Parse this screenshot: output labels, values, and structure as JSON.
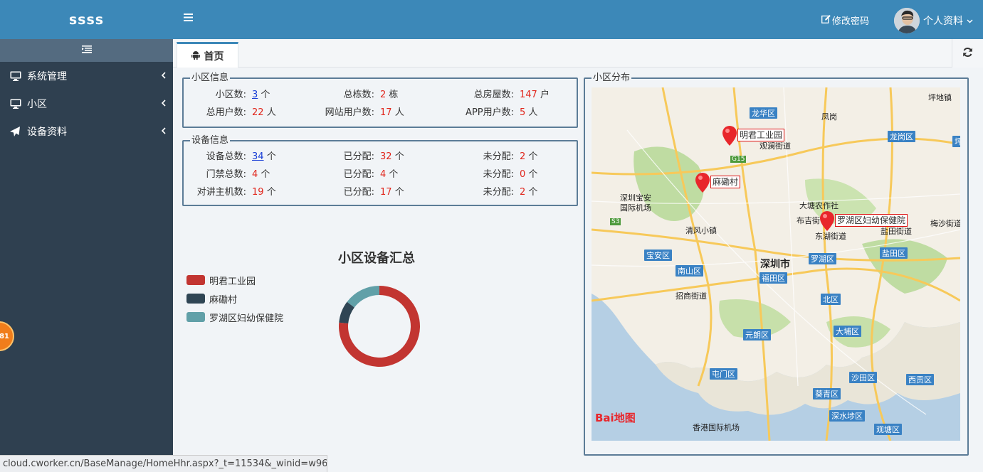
{
  "sidebar": {
    "brand": "ssss",
    "items": [
      {
        "label": "系统管理",
        "icon": "monitor-icon"
      },
      {
        "label": "小区",
        "icon": "monitor-icon"
      },
      {
        "label": "设备资料",
        "icon": "send-icon"
      }
    ],
    "floating_badge": "81"
  },
  "header": {
    "change_password": "修改密码",
    "user_menu": "个人资料"
  },
  "tabs": [
    {
      "label": "首页",
      "icon": "android-icon"
    }
  ],
  "community_info": {
    "legend": "小区信息",
    "rows": [
      [
        {
          "label": "小区数:",
          "value": "3",
          "unit": "个",
          "link": true
        },
        {
          "label": "总栋数:",
          "value": "2",
          "unit": "栋"
        },
        {
          "label": "总房屋数:",
          "value": "147",
          "unit": "户"
        }
      ],
      [
        {
          "label": "总用户数:",
          "value": "22",
          "unit": "人"
        },
        {
          "label": "网站用户数:",
          "value": "17",
          "unit": "人"
        },
        {
          "label": "APP用户数:",
          "value": "5",
          "unit": "人"
        }
      ]
    ]
  },
  "device_info": {
    "legend": "设备信息",
    "rows": [
      [
        {
          "label": "设备总数:",
          "value": "34",
          "unit": "个",
          "link": true
        },
        {
          "label": "已分配:",
          "value": "32",
          "unit": "个"
        },
        {
          "label": "未分配:",
          "value": "2",
          "unit": "个"
        }
      ],
      [
        {
          "label": "门禁总数:",
          "value": "4",
          "unit": "个"
        },
        {
          "label": "已分配:",
          "value": "4",
          "unit": "个"
        },
        {
          "label": "未分配:",
          "value": "0",
          "unit": "个"
        }
      ],
      [
        {
          "label": "对讲主机数:",
          "value": "19",
          "unit": "个"
        },
        {
          "label": "已分配:",
          "value": "17",
          "unit": "个"
        },
        {
          "label": "未分配:",
          "value": "2",
          "unit": "个"
        }
      ]
    ]
  },
  "chart_data": {
    "type": "pie",
    "title": "小区设备汇总",
    "legend_position": "left",
    "categories": [
      "明君工业园",
      "麻磡村",
      "罗湖区妇幼保健院"
    ],
    "values": [
      26,
      3,
      5
    ],
    "colors": [
      "#c23531",
      "#2f4554",
      "#61a0a8"
    ]
  },
  "map": {
    "legend": "小区分布",
    "markers": [
      {
        "label": "明君工业园"
      },
      {
        "label": "麻磡村"
      },
      {
        "label": "罗湖区妇幼保健院"
      }
    ],
    "area_tags": [
      "龙华区",
      "龙岗区",
      "宝安区",
      "南山区",
      "福田区",
      "罗湖区",
      "盐田区",
      "北区",
      "大埔区",
      "元朗区",
      "屯门区",
      "沙田区",
      "西贡区",
      "葵青区",
      "深水埗区",
      "观塘区",
      "坪"
    ],
    "places": [
      "坪地镇",
      "凤岗",
      "深圳宝安",
      "国际机场",
      "大塘农作社",
      "布吉街",
      "东湖街道",
      "梅沙街道",
      "盐田街道",
      "清风小镇",
      "深圳市",
      "招商街道",
      "香港国际机场",
      "G15",
      "S3",
      "观澜街道"
    ],
    "provider": "Bai地图"
  },
  "statusbar": {
    "url": "cloud.cworker.cn/BaseManage/HomeHhr.aspx?_t=11534&_winid=w96..."
  }
}
